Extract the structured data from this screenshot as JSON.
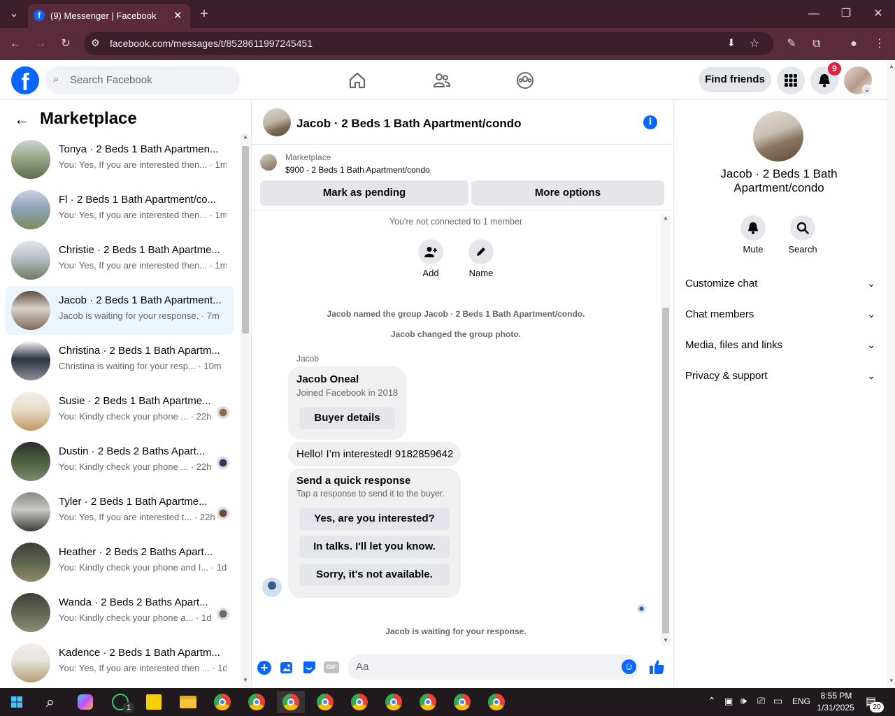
{
  "browser": {
    "tab_title": "(9) Messenger | Facebook",
    "url": "facebook.com/messages/t/8528611997245451"
  },
  "fb_header": {
    "search_placeholder": "Search Facebook",
    "find_friends": "Find friends",
    "notification_count": "9"
  },
  "left": {
    "title": "Marketplace",
    "conversations": [
      {
        "name": "Tonya · 2 Beds 1 Bath Apartmen...",
        "preview": "You: Yes, If you are interested then... · 1m",
        "active": false
      },
      {
        "name": "Fl · 2 Beds 1 Bath Apartment/co...",
        "preview": "You: Yes, If you are interested then... · 1m",
        "active": false
      },
      {
        "name": "Christie · 2 Beds 1 Bath Apartme...",
        "preview": "You: Yes, If you are interested then... · 1m",
        "active": false
      },
      {
        "name": "Jacob · 2 Beds 1 Bath Apartment...",
        "preview": "Jacob is waiting for your response. · 7m",
        "active": true
      },
      {
        "name": "Christina · 2 Beds 1 Bath Apartm...",
        "preview": "Christina is waiting for your resp... · 10m",
        "active": false
      },
      {
        "name": "Susie · 2 Beds 1 Bath Apartme...",
        "preview": "You: Kindly check your phone ... · 22h",
        "active": false
      },
      {
        "name": "Dustin · 2 Beds 2 Baths Apart...",
        "preview": "You: Kindly check your phone ... · 22h",
        "active": false
      },
      {
        "name": "Tyler · 2 Beds 1 Bath Apartme...",
        "preview": "You: Yes, If you are interested t... · 22h",
        "active": false
      },
      {
        "name": "Heather · 2 Beds 2 Baths Apart...",
        "preview": "You: Kindly check your phone and I... · 1d",
        "active": false
      },
      {
        "name": "Wanda · 2 Beds 2 Baths Apart...",
        "preview": "You: Kindly check your phone a... · 1d",
        "active": false
      },
      {
        "name": "Kadence · 2 Beds 1 Bath Apartm...",
        "preview": "You: Yes, If you are interested then ... · 1d",
        "active": false
      }
    ]
  },
  "chat": {
    "title": "Jacob · 2 Beds 1 Bath Apartment/condo",
    "listing_source": "Marketplace",
    "listing_title": "$900 - 2 Beds 1 Bath Apartment/condo",
    "mark_pending": "Mark as pending",
    "more_options": "More options",
    "not_connected": "You're not connected to 1 member",
    "add_label": "Add",
    "name_label": "Name",
    "sys_named": "Jacob named the group Jacob · 2 Beds 1 Bath Apartment/condo.",
    "sys_photo": "Jacob changed the group photo.",
    "sender": "Jacob",
    "profile_name": "Jacob Oneal",
    "profile_joined": "Joined Facebook in 2018",
    "buyer_details": "Buyer details",
    "message": "Hello! I’m interested! 9182859642",
    "quick_title": "Send a quick response",
    "quick_sub": "Tap a response to send it to the buyer.",
    "quick_replies": [
      "Yes, are you interested?",
      "In talks. I'll let you know.",
      "Sorry, it's not available."
    ],
    "waiting": "Jacob is waiting for your response.",
    "composer_placeholder": "Aa",
    "gif_label": "GIF"
  },
  "right": {
    "title": "Jacob · 2 Beds 1 Bath Apartment/condo",
    "mute": "Mute",
    "search": "Search",
    "sections": [
      "Customize chat",
      "Chat members",
      "Media, files and links",
      "Privacy & support"
    ]
  },
  "taskbar": {
    "time": "8:55 PM",
    "date": "1/31/2025",
    "lang": "ENG",
    "notif_count": "20",
    "whatsapp_badge": "1"
  },
  "colors": {
    "fb_blue": "#0866ff",
    "chrome_dark": "#3c1f2a",
    "chrome_mid": "#5a2b3a",
    "active_conv": "#ebf5ff",
    "notif_red": "#e41e3f"
  }
}
